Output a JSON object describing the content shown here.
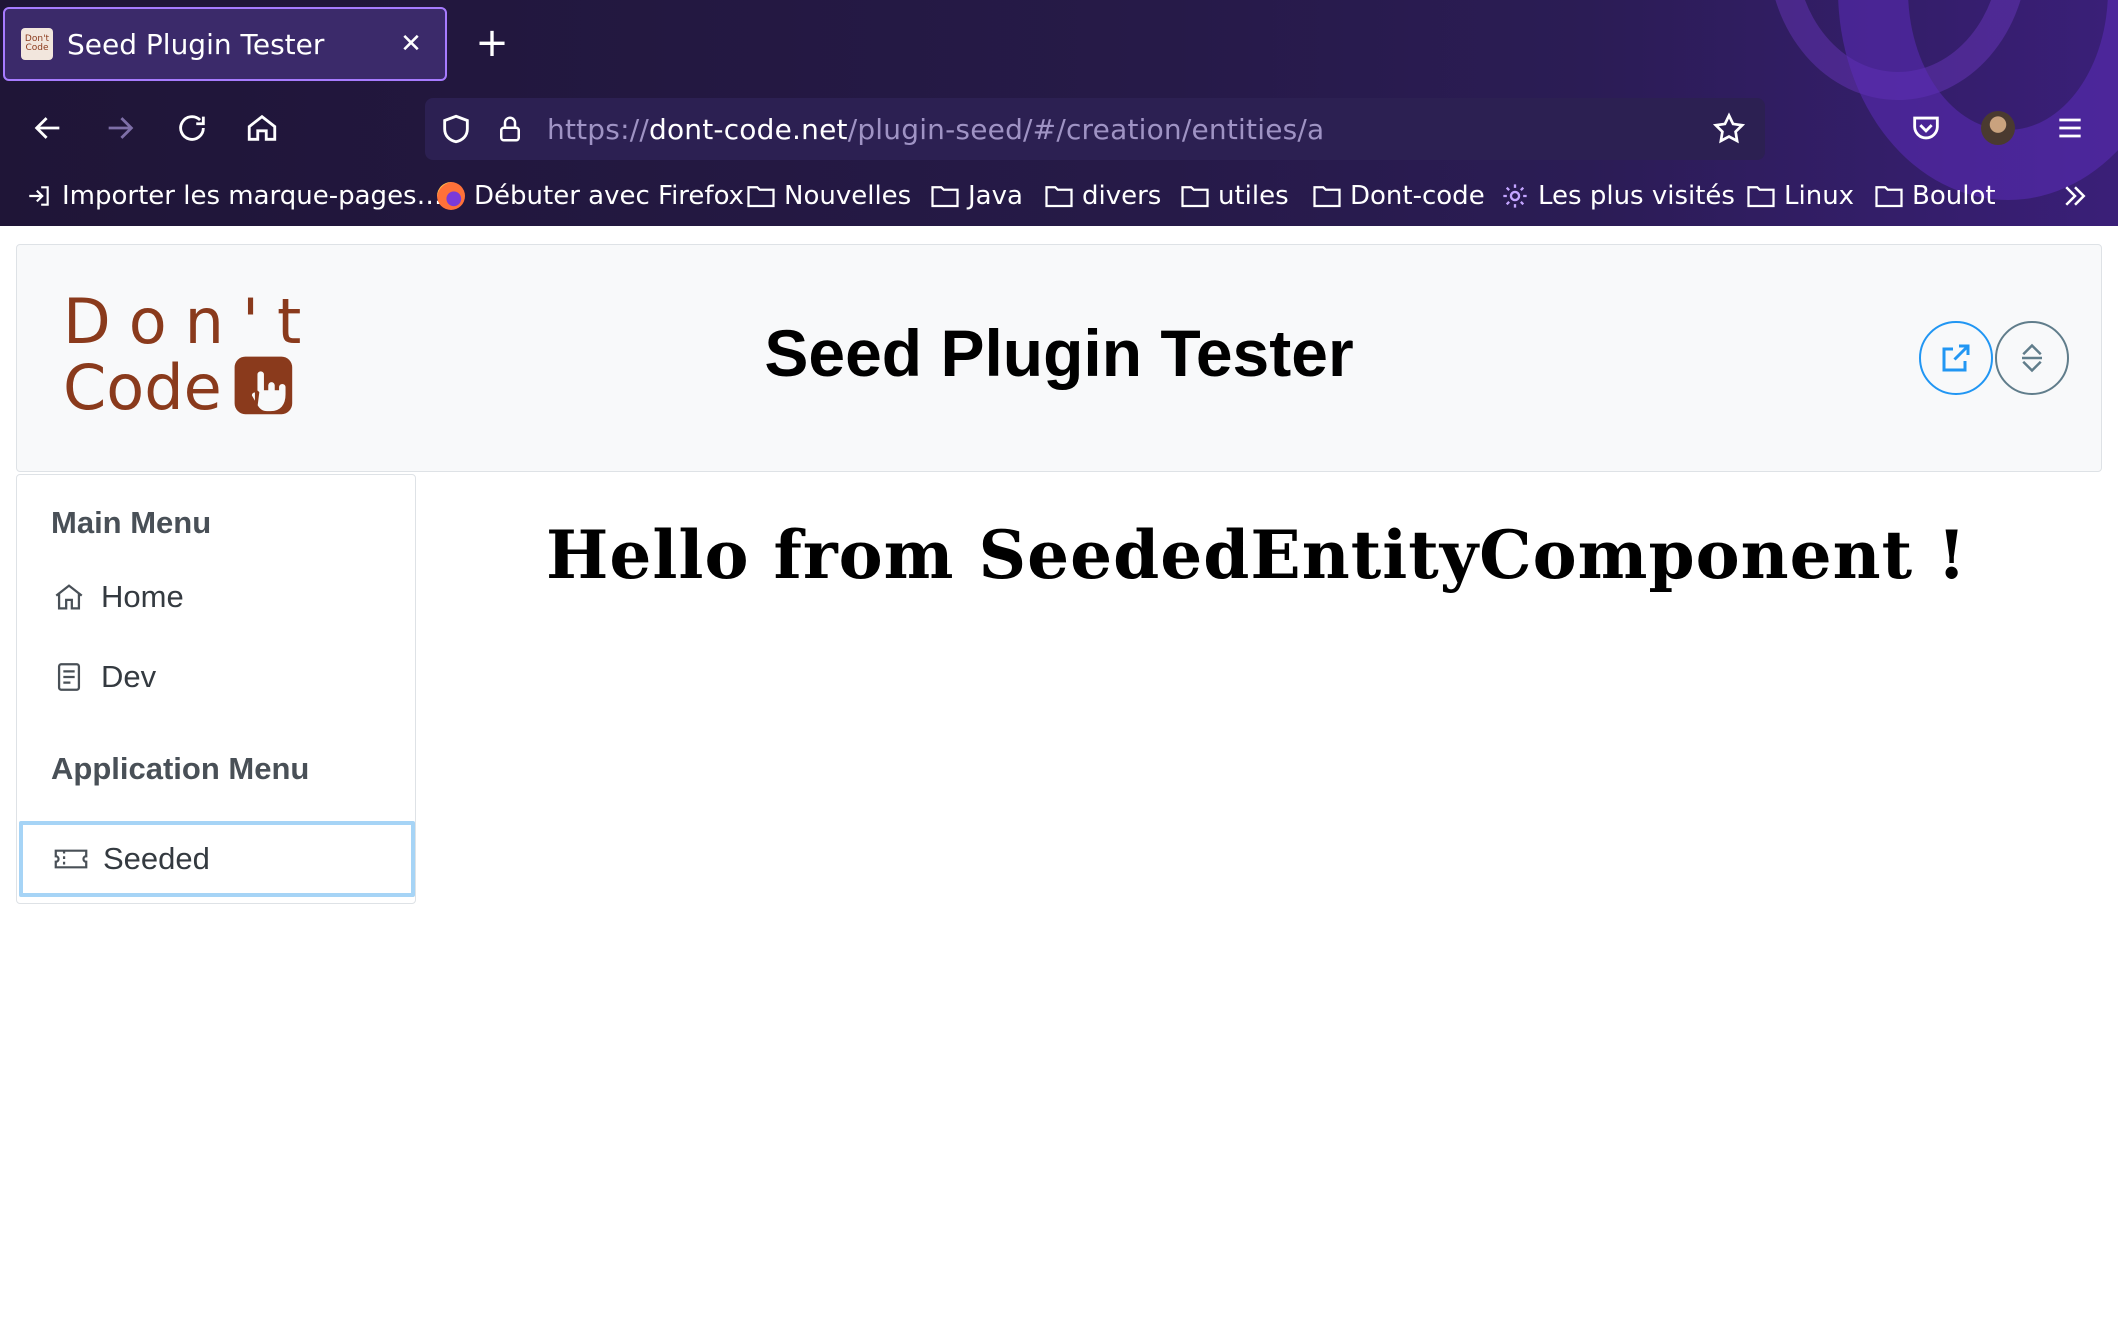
{
  "browser": {
    "tab": {
      "title": "Seed Plugin Tester",
      "favicon_text": "Don't Code"
    },
    "url": {
      "scheme": "https://",
      "host": "dont-code.net",
      "path": "/plugin-seed/#/creation/entities/a"
    },
    "icons": {
      "back": "arrow-left-icon",
      "forward": "arrow-right-icon",
      "reload": "reload-icon",
      "home": "home-icon",
      "tracking": "shield-icon",
      "lock": "lock-icon",
      "bookmark_star": "star-icon",
      "pocket": "pocket-icon",
      "account": "avatar",
      "menu": "hamburger-menu-icon",
      "new_tab": "plus-icon",
      "close_tab": "close-icon"
    },
    "bookmarks": [
      {
        "label": "Importer les marque-pages…",
        "icon": "import-icon"
      },
      {
        "label": "Débuter avec Firefox",
        "icon": "firefox-icon"
      },
      {
        "label": "Nouvelles",
        "icon": "folder-icon"
      },
      {
        "label": "Java",
        "icon": "folder-icon"
      },
      {
        "label": "divers",
        "icon": "folder-icon"
      },
      {
        "label": "utiles",
        "icon": "folder-icon"
      },
      {
        "label": "Dont-code",
        "icon": "folder-icon"
      },
      {
        "label": "Les plus visités",
        "icon": "gear-icon"
      },
      {
        "label": "Linux",
        "icon": "folder-icon"
      },
      {
        "label": "Boulot",
        "icon": "folder-icon"
      }
    ],
    "colors": {
      "chrome_bg": "#1f1537",
      "tab_border": "#a77bff",
      "url_bg": "#2c2052"
    }
  },
  "app": {
    "logo": {
      "line1": "Don't",
      "line2": "Code"
    },
    "title": "Seed Plugin Tester",
    "header_buttons": [
      {
        "name": "share-button",
        "icon": "external-link-icon"
      },
      {
        "name": "expand-collapse-button",
        "icon": "sort-arrows-icon"
      }
    ],
    "menu": {
      "main_header": "Main Menu",
      "main_items": [
        {
          "label": "Home",
          "icon": "home-icon"
        },
        {
          "label": "Dev",
          "icon": "book-icon"
        }
      ],
      "app_header": "Application Menu",
      "app_items": [
        {
          "label": "Seeded",
          "icon": "ticket-icon",
          "active": true
        }
      ]
    },
    "content": {
      "message": "Hello from SeededEntityComponent !"
    },
    "colors": {
      "logo_brown": "#8a3a1c",
      "accent_blue": "#2196f3",
      "active_border": "#a6d4f6"
    }
  }
}
